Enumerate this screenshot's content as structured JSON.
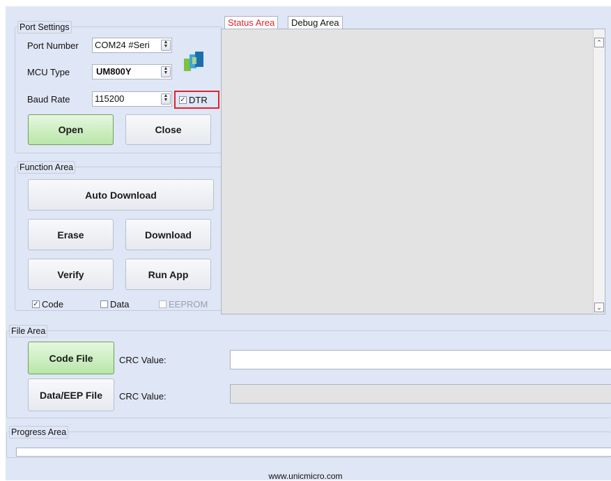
{
  "port_settings": {
    "title": "Port Settings",
    "port_number_label": "Port Number",
    "port_number_value": "COM24 #Seri",
    "mcu_type_label": "MCU Type",
    "mcu_type_value": "UM800Y",
    "baud_rate_label": "Baud Rate",
    "baud_rate_value": "115200",
    "dtr_label": "DTR",
    "dtr_checked": true,
    "open_label": "Open",
    "close_label": "Close"
  },
  "function_area": {
    "title": "Function Area",
    "auto_download_label": "Auto Download",
    "erase_label": "Erase",
    "download_label": "Download",
    "verify_label": "Verify",
    "run_app_label": "Run App",
    "code_label": "Code",
    "data_label": "Data",
    "eeprom_label": "EEPROM"
  },
  "tabs": [
    "Status Area",
    "Debug Area"
  ],
  "file_area": {
    "title": "File Area",
    "code_file_label": "Code File",
    "crc_label_1": "CRC Value:",
    "data_eep_file_label": "Data/EEP File",
    "crc_label_2": "CRC Value:"
  },
  "progress_area": {
    "title": "Progress Area",
    "progress": 0
  },
  "footer": {
    "website": "www.unicmicro.com"
  },
  "colors": {
    "active_tab_text": "#e0232b",
    "highlight_box": "#e0232b",
    "green_button": "#b9e6a9"
  },
  "icons": [
    "app-logo-icon",
    "checkbox-icon",
    "spin-arrows-icon",
    "scroll-up-icon",
    "scroll-down-icon"
  ]
}
